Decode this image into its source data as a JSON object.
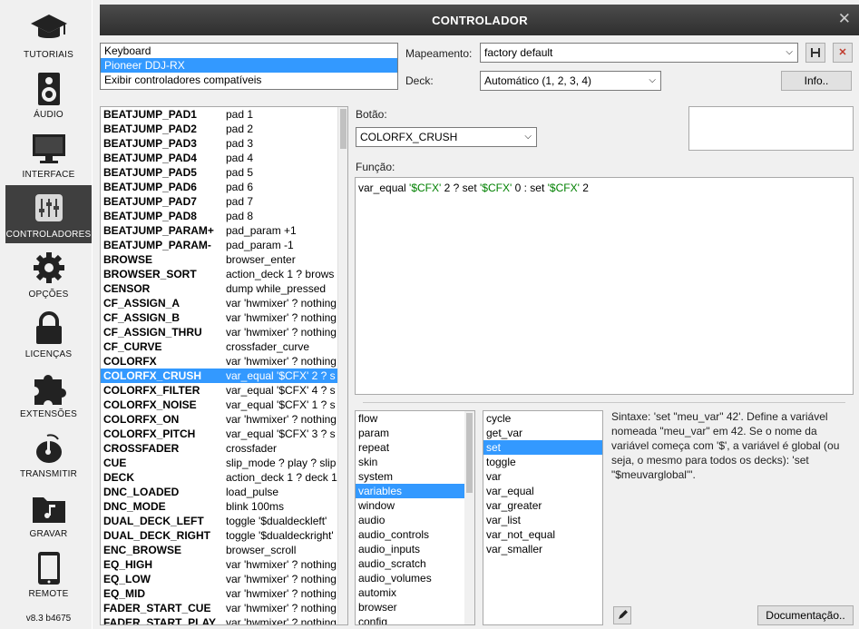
{
  "sidebar": {
    "items": [
      {
        "label": "TUTORIAIS",
        "icon": "graduation-cap-icon"
      },
      {
        "label": "ÁUDIO",
        "icon": "speaker-icon"
      },
      {
        "label": "INTERFACE",
        "icon": "monitor-icon"
      },
      {
        "label": "CONTROLADORES",
        "icon": "sliders-icon",
        "active": true
      },
      {
        "label": "OPÇÕES",
        "icon": "gear-icon"
      },
      {
        "label": "LICENÇAS",
        "icon": "lock-icon"
      },
      {
        "label": "EXTENSÕES",
        "icon": "puzzle-icon"
      },
      {
        "label": "TRANSMITIR",
        "icon": "broadcast-icon"
      },
      {
        "label": "GRAVAR",
        "icon": "folder-music-icon"
      },
      {
        "label": "REMOTE",
        "icon": "tablet-icon"
      }
    ],
    "version": "v8.3 b4675"
  },
  "window": {
    "title": "CONTROLADOR",
    "close": "✕"
  },
  "controllers": [
    {
      "label": "Keyboard"
    },
    {
      "label": "Pioneer DDJ-RX",
      "selected": true
    },
    {
      "label": "Exibir controladores compatíveis"
    }
  ],
  "mapping": {
    "label": "Mapeamento:",
    "value": "factory default",
    "save_icon": "save-icon",
    "delete_icon": "delete-icon"
  },
  "deck": {
    "label": "Deck:",
    "value": "Automático (1, 2, 3, 4)"
  },
  "info_button": "Info..",
  "key_label": "Botão:",
  "key_value": "COLORFX_CRUSH",
  "function_label": "Função:",
  "script": {
    "parts": [
      {
        "t": "var_equal "
      },
      {
        "t": "'$CFX'",
        "s": true
      },
      {
        "t": " 2 ? set "
      },
      {
        "t": "'$CFX'",
        "s": true
      },
      {
        "t": " 0 : set "
      },
      {
        "t": "'$CFX'",
        "s": true
      },
      {
        "t": " 2"
      }
    ]
  },
  "mappings": [
    {
      "k": "BEATJUMP_PAD1",
      "v": "pad 1"
    },
    {
      "k": "BEATJUMP_PAD2",
      "v": "pad 2"
    },
    {
      "k": "BEATJUMP_PAD3",
      "v": "pad 3"
    },
    {
      "k": "BEATJUMP_PAD4",
      "v": "pad 4"
    },
    {
      "k": "BEATJUMP_PAD5",
      "v": "pad 5"
    },
    {
      "k": "BEATJUMP_PAD6",
      "v": "pad 6"
    },
    {
      "k": "BEATJUMP_PAD7",
      "v": "pad 7"
    },
    {
      "k": "BEATJUMP_PAD8",
      "v": "pad 8"
    },
    {
      "k": "BEATJUMP_PARAM+",
      "v": "pad_param +1"
    },
    {
      "k": "BEATJUMP_PARAM-",
      "v": "pad_param -1"
    },
    {
      "k": "BROWSE",
      "v": "browser_enter"
    },
    {
      "k": "BROWSER_SORT",
      "v": "action_deck 1 ? brows"
    },
    {
      "k": "CENSOR",
      "v": "dump while_pressed"
    },
    {
      "k": "CF_ASSIGN_A",
      "v": "var 'hwmixer' ? nothing"
    },
    {
      "k": "CF_ASSIGN_B",
      "v": "var 'hwmixer' ? nothing"
    },
    {
      "k": "CF_ASSIGN_THRU",
      "v": "var 'hwmixer' ? nothing"
    },
    {
      "k": "CF_CURVE",
      "v": "crossfader_curve"
    },
    {
      "k": "COLORFX",
      "v": "var 'hwmixer' ? nothing"
    },
    {
      "k": "COLORFX_CRUSH",
      "v": "var_equal '$CFX' 2 ? s",
      "selected": true
    },
    {
      "k": "COLORFX_FILTER",
      "v": "var_equal '$CFX' 4 ? s"
    },
    {
      "k": "COLORFX_NOISE",
      "v": "var_equal '$CFX' 1 ? s"
    },
    {
      "k": "COLORFX_ON",
      "v": "var 'hwmixer' ? nothing"
    },
    {
      "k": "COLORFX_PITCH",
      "v": "var_equal '$CFX' 3 ? s"
    },
    {
      "k": "CROSSFADER",
      "v": "crossfader"
    },
    {
      "k": "CUE",
      "v": "slip_mode ? play ? slip"
    },
    {
      "k": "DECK",
      "v": "action_deck 1 ? deck 1"
    },
    {
      "k": "DNC_LOADED",
      "v": "load_pulse"
    },
    {
      "k": "DNC_MODE",
      "v": "blink 100ms"
    },
    {
      "k": "DUAL_DECK_LEFT",
      "v": "toggle '$dualdeckleft'"
    },
    {
      "k": "DUAL_DECK_RIGHT",
      "v": "toggle '$dualdeckright'"
    },
    {
      "k": "ENC_BROWSE",
      "v": "browser_scroll"
    },
    {
      "k": "EQ_HIGH",
      "v": "var 'hwmixer' ? nothing"
    },
    {
      "k": "EQ_LOW",
      "v": "var 'hwmixer' ? nothing"
    },
    {
      "k": "EQ_MID",
      "v": "var 'hwmixer' ? nothing"
    },
    {
      "k": "FADER_START_CUE",
      "v": "var 'hwmixer' ? nothing"
    },
    {
      "k": "FADER_START_PLAY",
      "v": "var 'hwmixer' ? nothing"
    }
  ],
  "categories": [
    {
      "label": "flow"
    },
    {
      "label": "param"
    },
    {
      "label": "repeat"
    },
    {
      "label": "skin"
    },
    {
      "label": "system"
    },
    {
      "label": "variables",
      "selected": true
    },
    {
      "label": "window"
    },
    {
      "label": "audio"
    },
    {
      "label": "audio_controls"
    },
    {
      "label": "audio_inputs"
    },
    {
      "label": "audio_scratch"
    },
    {
      "label": "audio_volumes"
    },
    {
      "label": "automix"
    },
    {
      "label": "browser"
    },
    {
      "label": "config"
    }
  ],
  "verbs": [
    {
      "label": "cycle"
    },
    {
      "label": "get_var"
    },
    {
      "label": "set",
      "selected": true
    },
    {
      "label": "toggle"
    },
    {
      "label": "var"
    },
    {
      "label": "var_equal"
    },
    {
      "label": "var_greater"
    },
    {
      "label": "var_list"
    },
    {
      "label": "var_not_equal"
    },
    {
      "label": "var_smaller"
    }
  ],
  "syntax_text": "Sintaxe: 'set \"meu_var\" 42'. Define a variável nomeada \"meu_var\" em 42. Se o nome da variável começa com '$', a variável é global (ou seja, o mesmo para todos os decks): 'set \"$meuvarglobal\"'.",
  "doc_button": "Documentação..",
  "pen_icon": "pen-icon"
}
